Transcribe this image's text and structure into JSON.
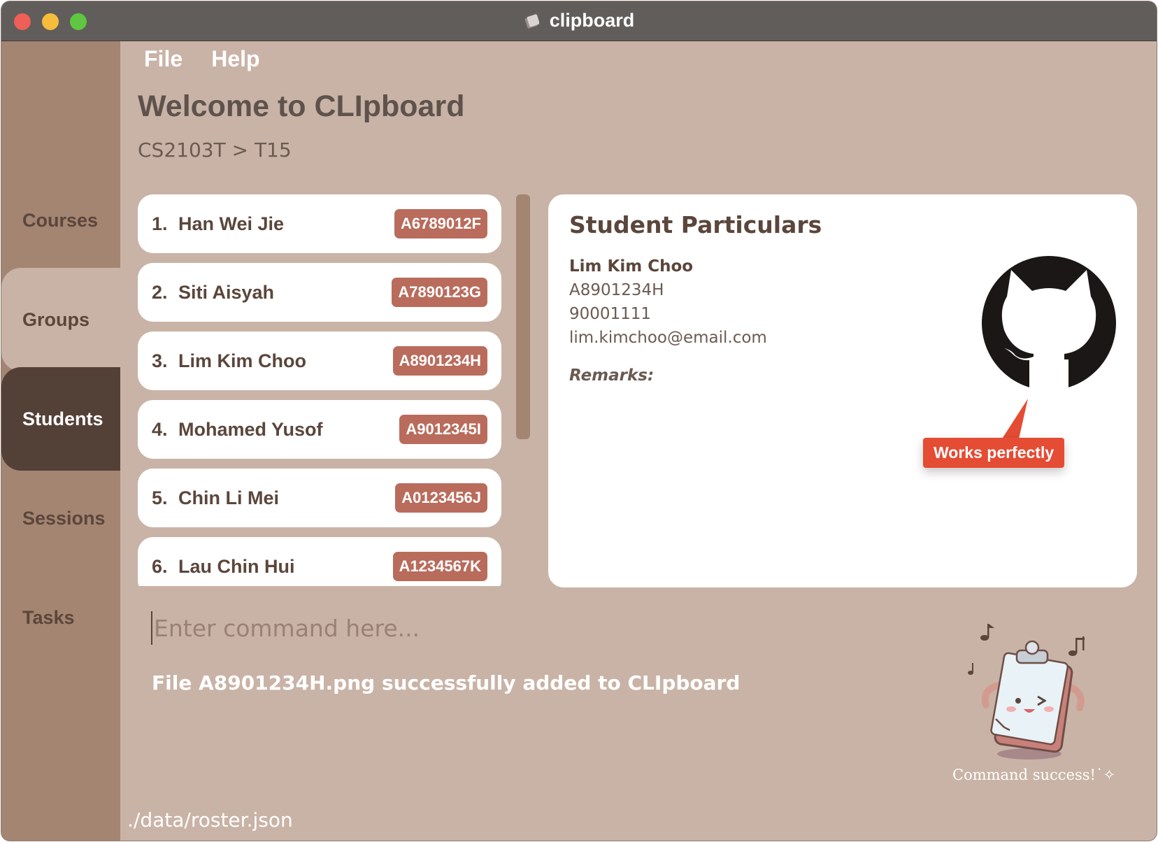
{
  "window": {
    "title": "clipboard",
    "title_icon": "clipboard-app-icon"
  },
  "sidebar": {
    "items": [
      {
        "label": "Courses",
        "active": false
      },
      {
        "label": "Groups",
        "active": false
      },
      {
        "label": "Students",
        "active": true
      },
      {
        "label": "Sessions",
        "active": false
      },
      {
        "label": "Tasks",
        "active": false
      }
    ]
  },
  "menubar": {
    "file": "File",
    "help": "Help"
  },
  "header": {
    "title": "Welcome to CLIpboard",
    "breadcrumb": "CS2103T > T15"
  },
  "students": [
    {
      "index": "1.",
      "name": "Han Wei Jie",
      "id": "A6789012F"
    },
    {
      "index": "2.",
      "name": "Siti Aisyah",
      "id": "A7890123G"
    },
    {
      "index": "3.",
      "name": "Lim Kim Choo",
      "id": "A8901234H"
    },
    {
      "index": "4.",
      "name": "Mohamed Yusof",
      "id": "A9012345I"
    },
    {
      "index": "5.",
      "name": "Chin Li Mei",
      "id": "A0123456J"
    },
    {
      "index": "6.",
      "name": "Lau Chin Hui",
      "id": "A1234567K"
    }
  ],
  "particulars": {
    "heading": "Student Particulars",
    "name": "Lim Kim Choo",
    "student_id": "A8901234H",
    "phone": "90001111",
    "email": "lim.kimchoo@email.com",
    "remarks_label": "Remarks:",
    "avatar_icon": "github-octocat-icon",
    "callout": "Works perfectly"
  },
  "command": {
    "placeholder": "Enter command here...",
    "value": ""
  },
  "result": {
    "message": "File A8901234H.png successfully added to CLIpboard"
  },
  "mascot": {
    "caption": "Command success!˙✧"
  },
  "footer": {
    "path": "./data/roster.json"
  },
  "colors": {
    "background": "#c9b3a6",
    "sidebar": "#a48572",
    "active_tab": "#534037",
    "badge": "#b96c5c",
    "callout": "#e44c33",
    "text_dark": "#5b463b"
  }
}
